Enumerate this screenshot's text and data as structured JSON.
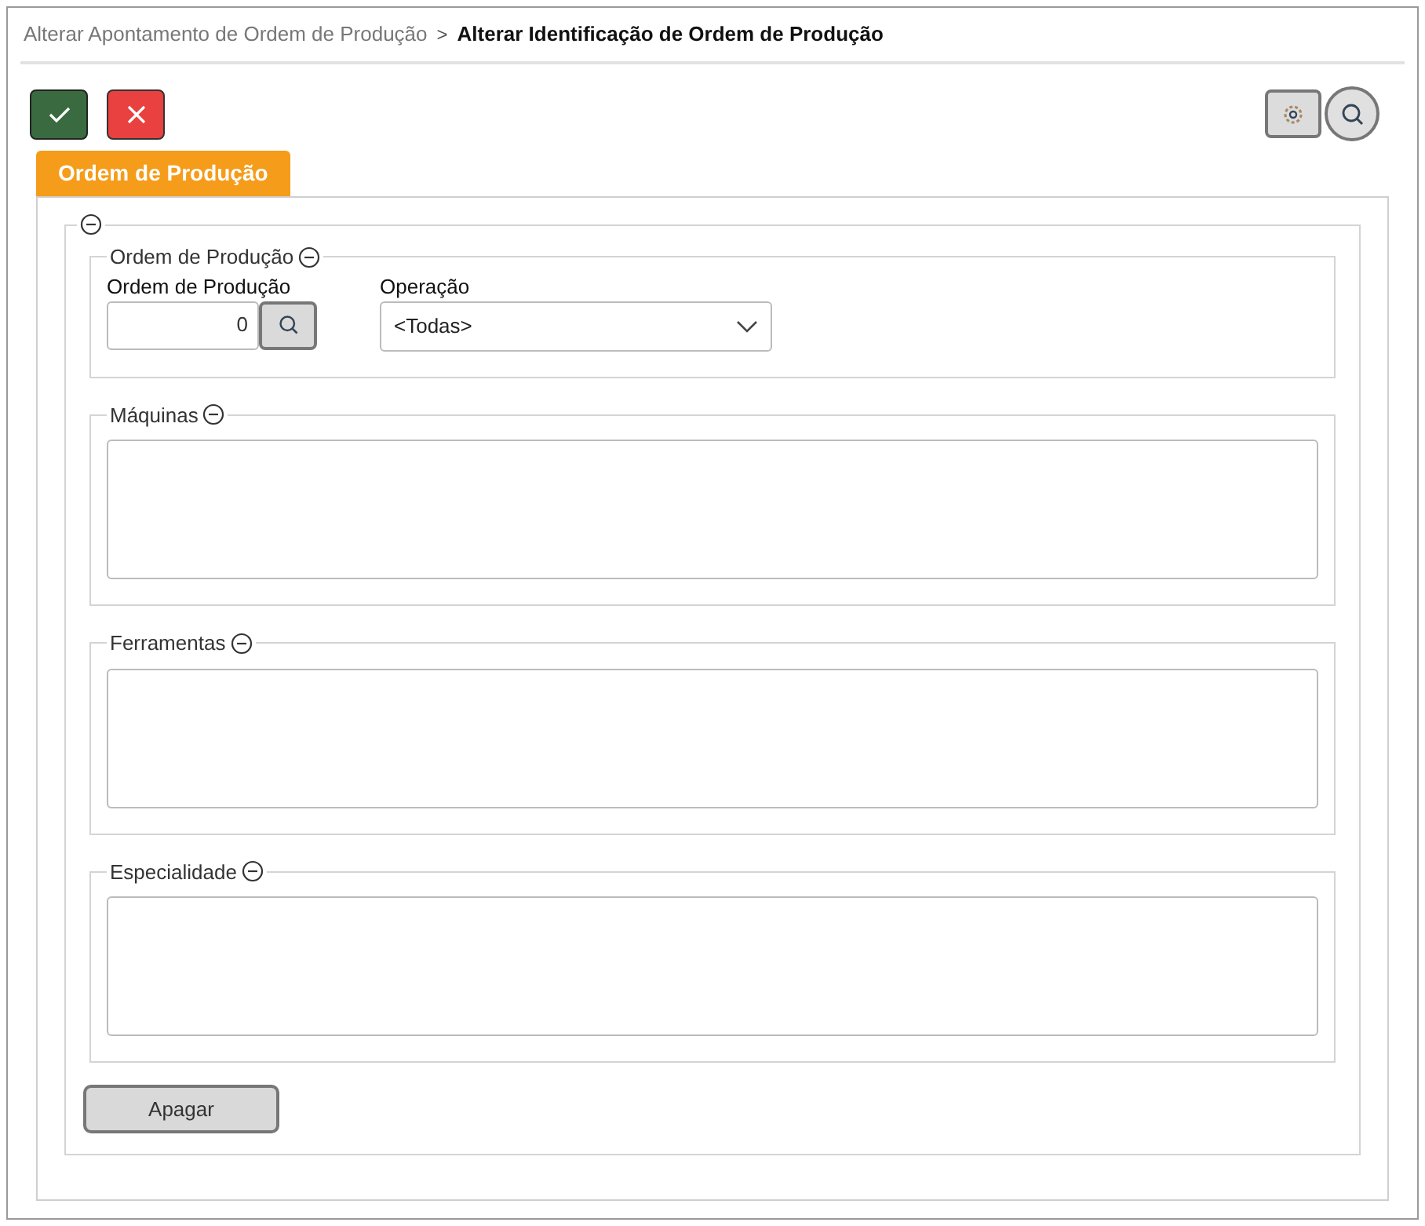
{
  "breadcrumb": [
    {
      "label": "Alterar Apontamento de Ordem de Produção",
      "current": false
    },
    {
      "label": "Alterar Identificação de Ordem de Produção",
      "current": true
    }
  ],
  "breadcrumb_separator": ">",
  "tabs": [
    {
      "label": "Ordem de Produção",
      "selected": true
    }
  ],
  "filter_group": {
    "title": "Ordem de Produção",
    "expanded": true,
    "fields": [
      {
        "kind": "lookup",
        "label": "Ordem de Produção",
        "value": "0"
      },
      {
        "kind": "select",
        "label": "Operação",
        "value": "<Todas>"
      }
    ]
  },
  "list_groups": [
    {
      "title": "Máquinas",
      "expanded": true
    },
    {
      "title": "Ferramentas",
      "expanded": true
    },
    {
      "title": "Especialidade",
      "expanded": true
    }
  ],
  "clear_button": "Apagar"
}
